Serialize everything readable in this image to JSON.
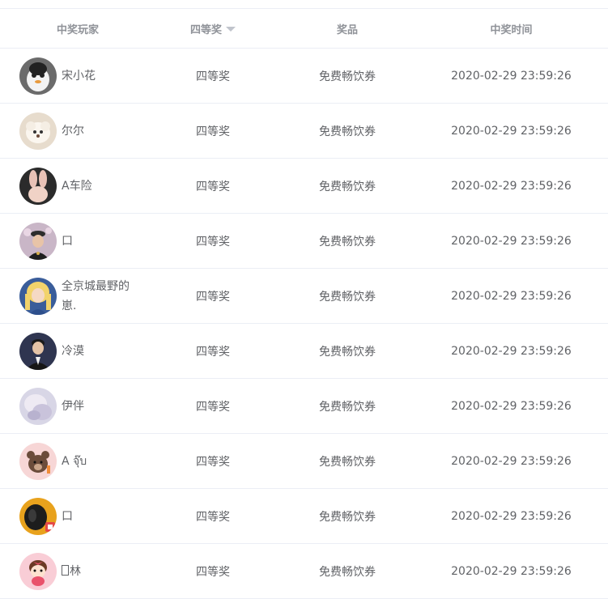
{
  "table": {
    "headers": {
      "player": "中奖玩家",
      "tier": "四等奖",
      "prize": "奖品",
      "time": "中奖时间"
    },
    "rows": [
      {
        "name": "宋小花",
        "tier": "四等奖",
        "prize": "免费畅饮券",
        "time": "2020-02-29 23:59:26",
        "avatar": "cartoon-penguin-avatar"
      },
      {
        "name": "尔尔",
        "tier": "四等奖",
        "prize": "免费畅饮券",
        "time": "2020-02-29 23:59:26",
        "avatar": "fluffy-dog-avatar"
      },
      {
        "name": "A车险",
        "tier": "四等奖",
        "prize": "免费畅饮券",
        "time": "2020-02-29 23:59:26",
        "avatar": "bunny-ears-avatar"
      },
      {
        "name": "口",
        "tier": "四等奖",
        "prize": "免费畅饮券",
        "time": "2020-02-29 23:59:26",
        "avatar": "cap-portrait-avatar"
      },
      {
        "name": "全京城最野的崽.",
        "tier": "四等奖",
        "prize": "免费畅饮券",
        "time": "2020-02-29 23:59:26",
        "avatar": "blonde-girl-avatar"
      },
      {
        "name": "冷漠",
        "tier": "四等奖",
        "prize": "免费畅饮券",
        "time": "2020-02-29 23:59:26",
        "avatar": "man-in-suit-avatar"
      },
      {
        "name": "伊伴",
        "tier": "四等奖",
        "prize": "免费畅饮券",
        "time": "2020-02-29 23:59:26",
        "avatar": "soft-pastel-avatar"
      },
      {
        "name": "A จุ๊บ",
        "tier": "四等奖",
        "prize": "免费畅饮券",
        "time": "2020-02-29 23:59:26",
        "avatar": "brown-bear-avatar"
      },
      {
        "name": "口",
        "tier": "四等奖",
        "prize": "免费畅饮券",
        "time": "2020-02-29 23:59:26",
        "avatar": "dark-helmet-avatar"
      },
      {
        "name": "林",
        "name_prefix_glyph": "unknown-glyph",
        "tier": "四等奖",
        "prize": "免费畅饮券",
        "time": "2020-02-29 23:59:26",
        "avatar": "cartoon-girl-avatar"
      }
    ]
  },
  "colors": {
    "text": "#606266",
    "header_text": "#909399",
    "divider": "#ebeef5",
    "sort_caret": "#c0c4cc"
  }
}
